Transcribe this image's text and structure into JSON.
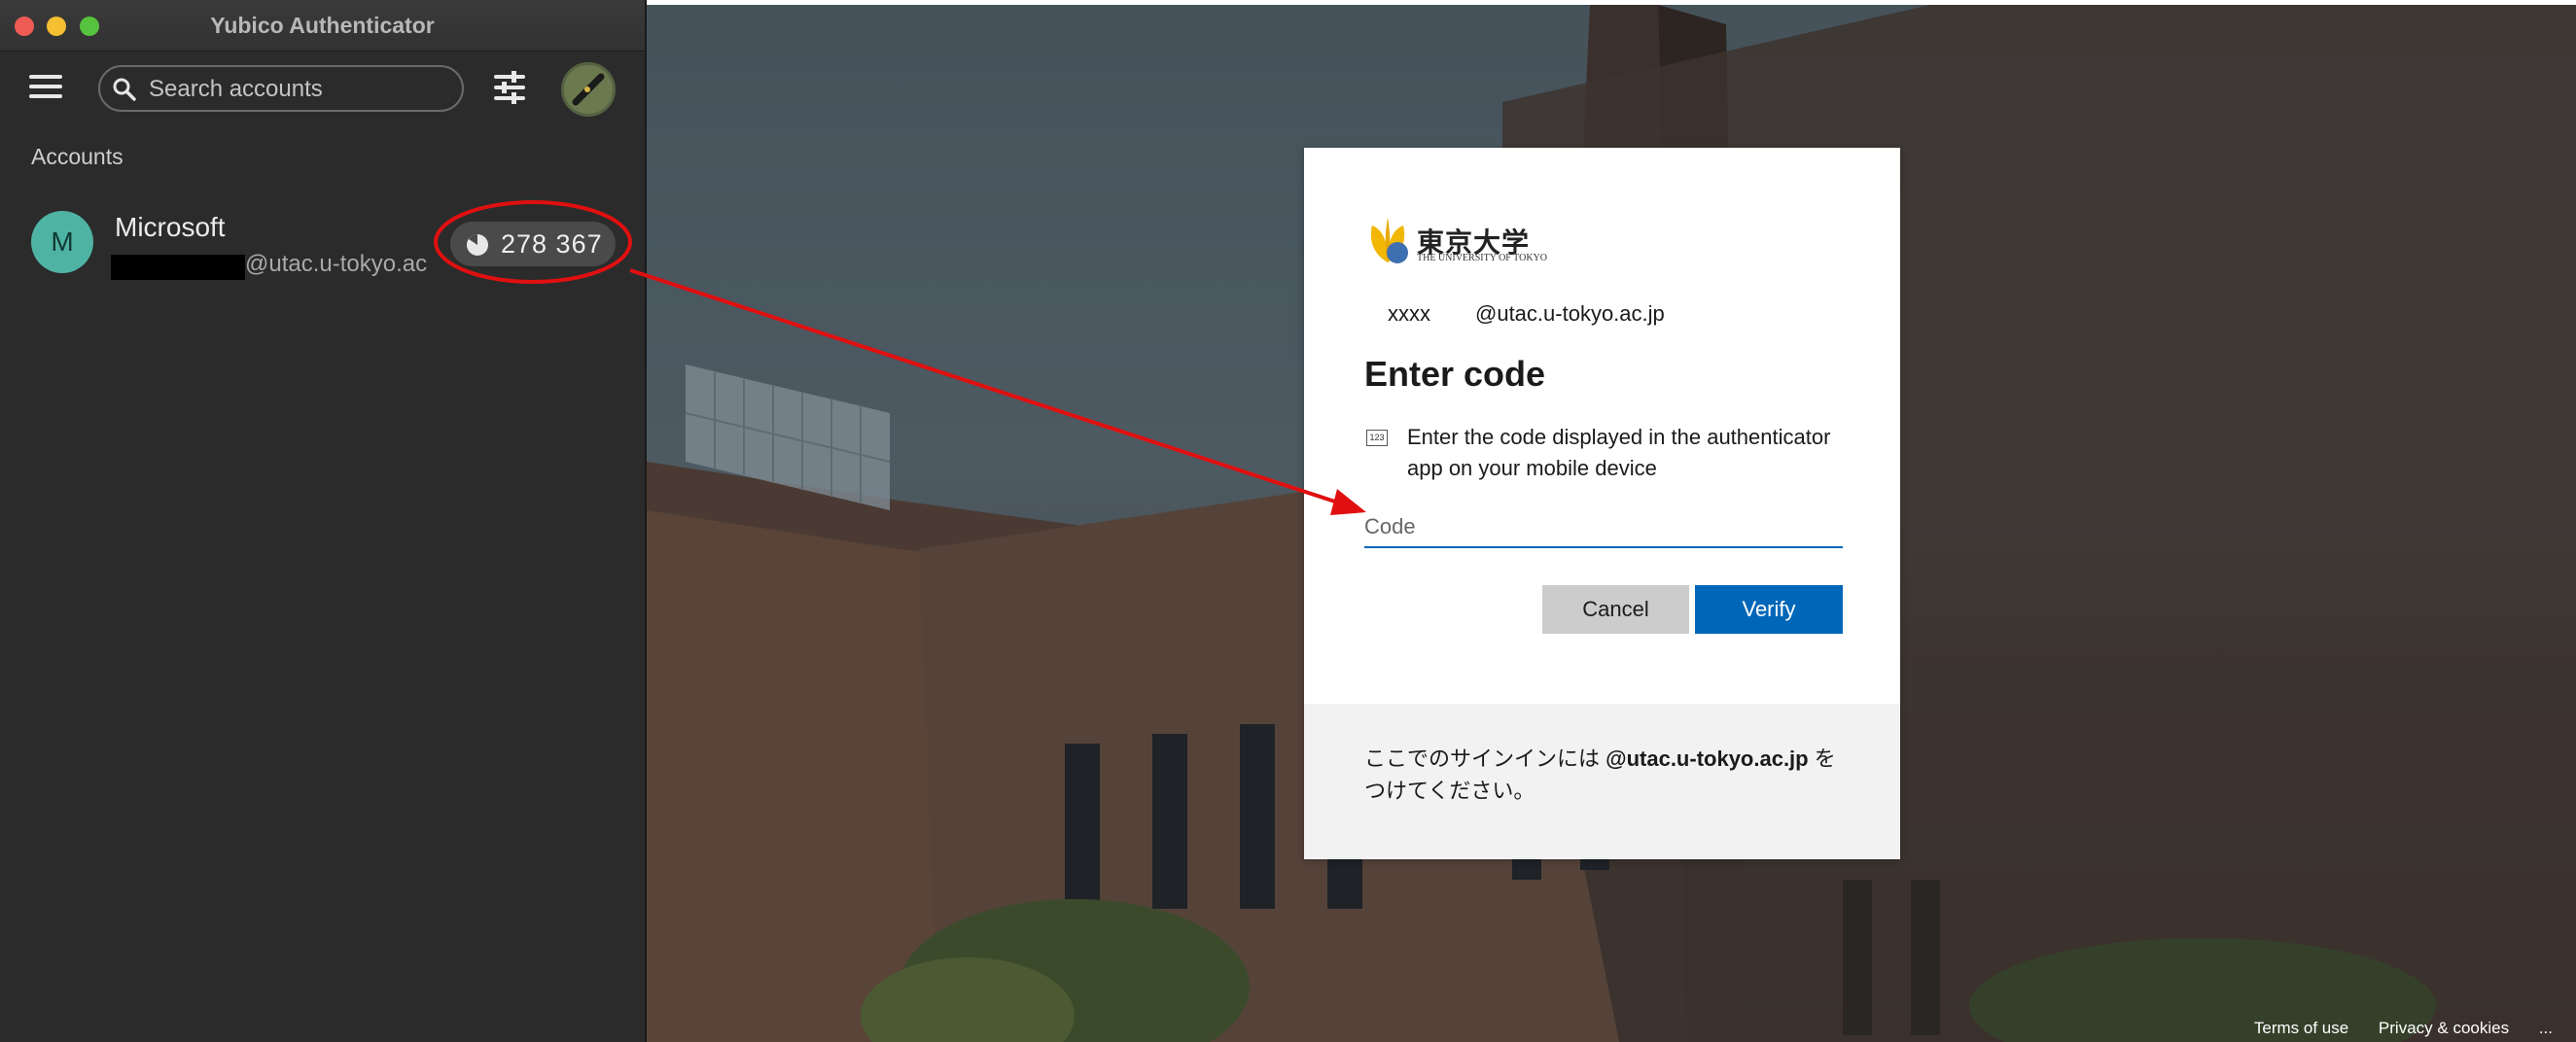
{
  "yubico": {
    "window_title": "Yubico Authenticator",
    "search_placeholder": "Search accounts",
    "section_label": "Accounts",
    "account": {
      "avatar_letter": "M",
      "name": "Microsoft",
      "email_suffix": "@utac.u-tokyo.ac",
      "code": "278 367"
    }
  },
  "login": {
    "logo_main": "東京大学",
    "logo_sub": "THE UNIVERSITY OF TOKYO",
    "user_id": "xxxx",
    "user_domain": "@utac.u-tokyo.ac.jp",
    "title": "Enter code",
    "number_icon": "123",
    "description": "Enter the code displayed in the authenticator app on your mobile device",
    "code_placeholder": "Code",
    "cancel_label": "Cancel",
    "verify_label": "Verify",
    "footer_pre": "ここでのサインインには ",
    "footer_bold": "@utac.u-tokyo.ac.jp",
    "footer_post": " をつけてください。"
  },
  "page_footer": {
    "terms": "Terms of use",
    "privacy": "Privacy & cookies",
    "more": "..."
  },
  "colors": {
    "accent": "#0067b8",
    "annotation": "#e01010",
    "avatar": "#4fb3a4"
  }
}
